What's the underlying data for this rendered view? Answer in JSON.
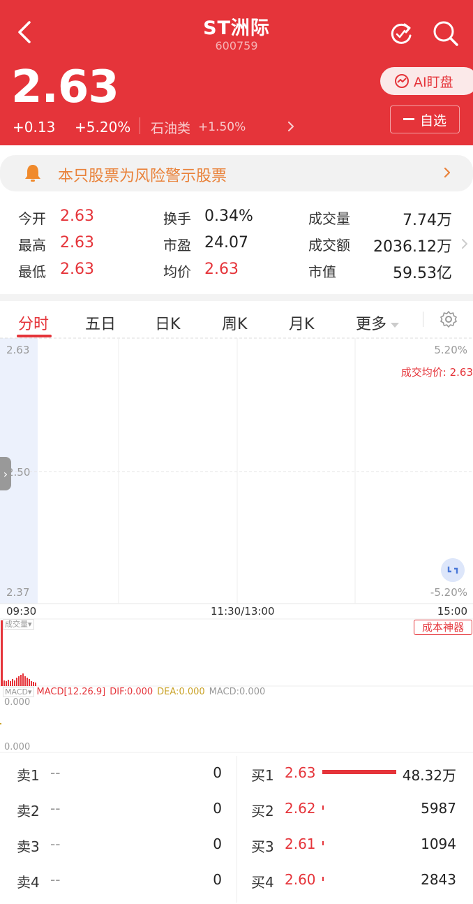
{
  "header": {
    "title": "ST洲际",
    "code": "600759",
    "price": "2.63",
    "change": "+0.13",
    "change_pct": "+5.20%",
    "sector_name": "石油类",
    "sector_change": "+1.50%",
    "ai_label": "AI盯盘",
    "watch_label": "自选"
  },
  "warning": {
    "text": "本只股票为风险警示股票"
  },
  "stats": [
    {
      "label": "今开",
      "value": "2.63"
    },
    {
      "label": "换手",
      "value": "0.34%"
    },
    {
      "label": "成交量",
      "value": "7.74万"
    },
    {
      "label": "最高",
      "value": "2.63"
    },
    {
      "label": "市盈",
      "value": "24.07"
    },
    {
      "label": "成交额",
      "value": "2036.12万"
    },
    {
      "label": "最低",
      "value": "2.63"
    },
    {
      "label": "均价",
      "value": "2.63"
    },
    {
      "label": "市值",
      "value": "59.53亿"
    }
  ],
  "tabs": [
    {
      "label": "分时",
      "active": true
    },
    {
      "label": "五日",
      "active": false
    },
    {
      "label": "日K",
      "active": false
    },
    {
      "label": "周K",
      "active": false
    },
    {
      "label": "月K",
      "active": false
    },
    {
      "label": "更多",
      "active": false
    }
  ],
  "chart": {
    "y_top": "2.63",
    "y_mid": "2.50",
    "y_bottom": "2.37",
    "pct_top": "5.20%",
    "pct_bottom": "-5.20%",
    "avg_label": "成交均价: 2.63",
    "time_start": "09:30",
    "time_mid": "11:30/13:00",
    "time_end": "15:00",
    "volume_tag": "成交量",
    "cost_button": "成本神器",
    "macd_tag": "MACD",
    "macd_params": "MACD[12.26.9]",
    "dif": "DIF:0.000",
    "dea": "DEA:0.000",
    "macd_value": "MACD:0.000",
    "macd_y_top": "0.000",
    "macd_y_bottom": "0.000"
  },
  "order_book": {
    "sell": [
      {
        "label": "卖1",
        "price": "--",
        "volume": "0"
      },
      {
        "label": "卖2",
        "price": "--",
        "volume": "0"
      },
      {
        "label": "卖3",
        "price": "--",
        "volume": "0"
      },
      {
        "label": "卖4",
        "price": "--",
        "volume": "0"
      }
    ],
    "buy": [
      {
        "label": "买1",
        "price": "2.63",
        "volume": "48.32万",
        "share": 1.0
      },
      {
        "label": "买2",
        "price": "2.62",
        "volume": "5987",
        "share": 0.02
      },
      {
        "label": "买3",
        "price": "2.61",
        "volume": "1094",
        "share": 0.02
      },
      {
        "label": "买4",
        "price": "2.60",
        "volume": "2843",
        "share": 0.02
      }
    ]
  },
  "colors": {
    "header_bg": "#e5343a",
    "up_red": "#e5343a",
    "warning_orange": "#e9823a",
    "dea_yellow": "#c9a227"
  },
  "icons": [
    "back-icon",
    "refresh-icon",
    "search-icon",
    "ai-icon",
    "minus-icon",
    "bell-icon",
    "chevron-right-icon",
    "gear-icon",
    "expand-icon"
  ]
}
